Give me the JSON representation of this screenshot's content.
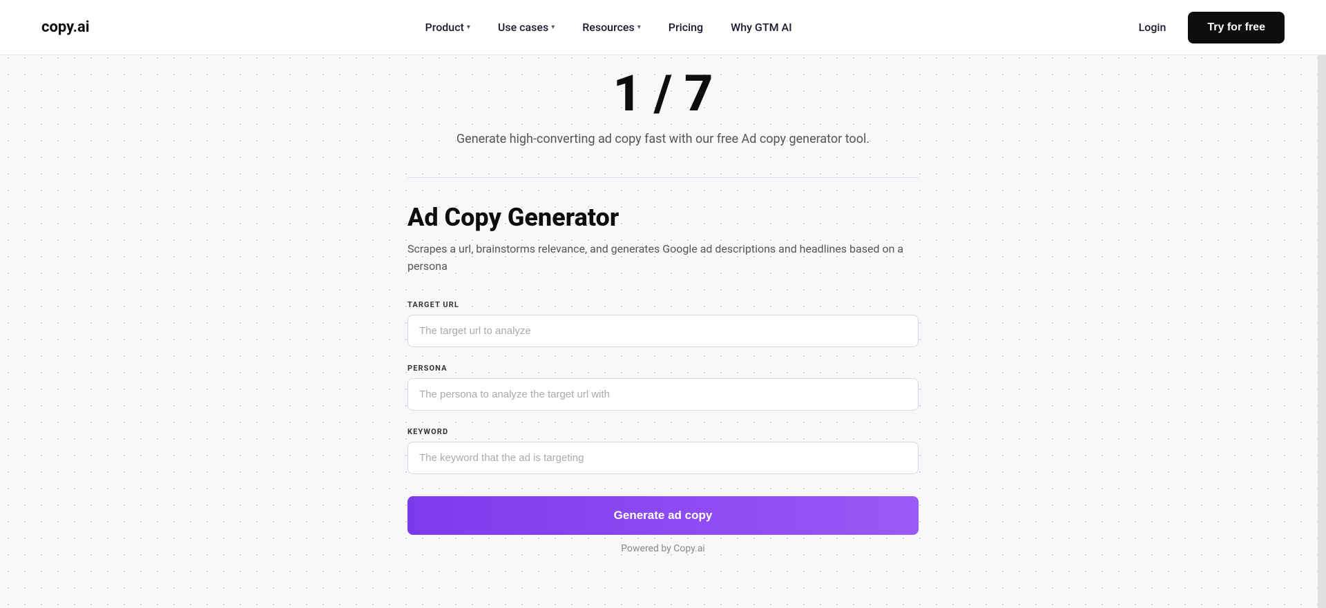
{
  "nav": {
    "logo": "copy.ai",
    "items": [
      {
        "label": "Product",
        "hasChevron": true
      },
      {
        "label": "Use cases",
        "hasChevron": true
      },
      {
        "label": "Resources",
        "hasChevron": true
      },
      {
        "label": "Pricing",
        "hasChevron": false
      },
      {
        "label": "Why GTM AI",
        "hasChevron": false
      }
    ],
    "login_label": "Login",
    "try_label": "Try for free"
  },
  "hero": {
    "numbers": "1 / 7",
    "subtitle": "Generate high-converting ad copy fast with our free Ad copy generator tool."
  },
  "tool": {
    "title": "Ad Copy Generator",
    "description": "Scrapes a url, brainstorms relevance, and generates Google ad descriptions and headlines based on a persona",
    "form": {
      "fields": [
        {
          "id": "target-url",
          "label": "TARGET URL",
          "placeholder": "The target url to analyze"
        },
        {
          "id": "persona",
          "label": "PERSONA",
          "placeholder": "The persona to analyze the target url with"
        },
        {
          "id": "keyword",
          "label": "KEYWORD",
          "placeholder": "The keyword that the ad is targeting"
        }
      ],
      "generate_label": "Generate ad copy",
      "powered_by": "Powered by Copy.ai"
    }
  }
}
